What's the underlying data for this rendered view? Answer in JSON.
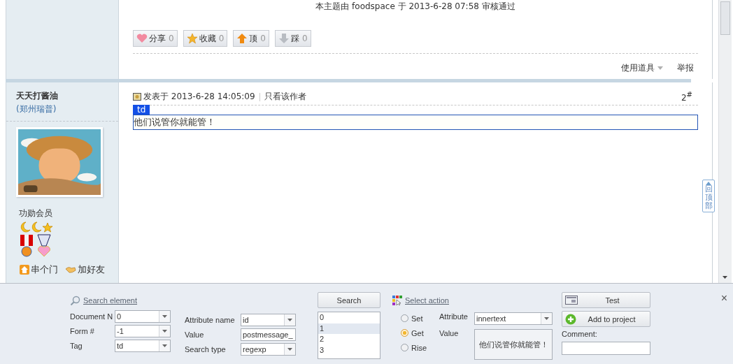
{
  "thread": {
    "moderation_note": "本主题由 foodspace 于 2013-6-28 07:58 审核通过",
    "actions": [
      {
        "kind": "share",
        "label": "分享",
        "count": "0"
      },
      {
        "kind": "favorite",
        "label": "收藏",
        "count": "0"
      },
      {
        "kind": "up",
        "label": "顶",
        "count": "0"
      },
      {
        "kind": "down",
        "label": "踩",
        "count": "0"
      }
    ],
    "tools_menu": "使用道具",
    "report": "举报"
  },
  "post": {
    "author": "天天打酱油",
    "author_group": "(郑州瑞普)",
    "rank": "功勋会员",
    "links": [
      {
        "kind": "visit",
        "label": "串个门"
      },
      {
        "kind": "friend",
        "label": "加好友"
      }
    ],
    "posted": "发表于 2013-6-28 14:05:09",
    "author_only": "只看该作者",
    "floor": "2$^{#}$",
    "highlight_tag": "td",
    "message": "他们说管你就能管！"
  },
  "back_to_top": "回顶部",
  "panel": {
    "search_element": "Search element",
    "fields_left": [
      {
        "label": "Document N",
        "value": "0",
        "kind": "dropdown"
      },
      {
        "label": "Form #",
        "value": "-1",
        "kind": "dropdown"
      },
      {
        "label": "Tag",
        "value": "td",
        "kind": "dropdown"
      }
    ],
    "fields_middle": [
      {
        "label": "Attribute name",
        "value": "id",
        "kind": "dropdown"
      },
      {
        "label": "Value",
        "value": "postmessage_",
        "kind": "text"
      },
      {
        "label": "Search type",
        "value": "regexp",
        "kind": "dropdown"
      }
    ],
    "search_button": "Search",
    "results": [
      {
        "label": "0",
        "selected": false
      },
      {
        "label": "1",
        "selected": true
      },
      {
        "label": "2",
        "selected": false
      },
      {
        "label": "3",
        "selected": false
      }
    ],
    "select_action": "Select action",
    "modes": [
      {
        "label": "Set",
        "selected": false
      },
      {
        "label": "Get",
        "selected": true
      },
      {
        "label": "Rise",
        "selected": false
      }
    ],
    "attribute_label": "Attribute",
    "attribute_value": "innertext",
    "value_label": "Value",
    "value_text": "他们说管你就能管！",
    "test_button": "Test",
    "add_button": "Add to project",
    "comment_label": "Comment:",
    "close": "×"
  }
}
